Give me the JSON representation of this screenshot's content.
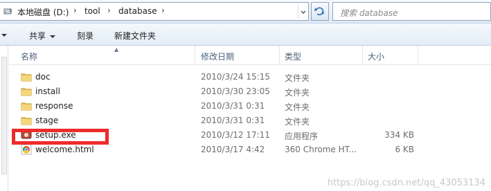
{
  "address_bar": {
    "crumbs": [
      "本地磁盘 (D:)",
      "tool",
      "database"
    ],
    "search_placeholder": "搜索 database"
  },
  "toolbar": {
    "share_label": "共享",
    "burn_label": "刻录",
    "new_folder_label": "新建文件夹"
  },
  "columns": {
    "name": "名称",
    "modified": "修改日期",
    "type": "类型",
    "size": "大小"
  },
  "files": [
    {
      "name": "doc",
      "modified": "2010/3/24 15:15",
      "type": "文件夹",
      "size": "",
      "icon": "folder-icon"
    },
    {
      "name": "install",
      "modified": "2010/3/30 23:05",
      "type": "文件夹",
      "size": "",
      "icon": "folder-icon"
    },
    {
      "name": "response",
      "modified": "2010/3/31 0:31",
      "type": "文件夹",
      "size": "",
      "icon": "folder-icon"
    },
    {
      "name": "stage",
      "modified": "2010/3/31 0:31",
      "type": "文件夹",
      "size": "",
      "icon": "folder-icon"
    },
    {
      "name": "setup.exe",
      "modified": "2010/3/12 17:11",
      "type": "应用程序",
      "size": "334 KB",
      "icon": "setup-exe-icon"
    },
    {
      "name": "welcome.html",
      "modified": "2010/3/17 4:42",
      "type": "360 Chrome HT...",
      "size": "6 KB",
      "icon": "chrome-html-icon"
    }
  ],
  "highlight_color": "#ee2b2b",
  "watermark": "https://blog.csdn.net/qq_43053134"
}
